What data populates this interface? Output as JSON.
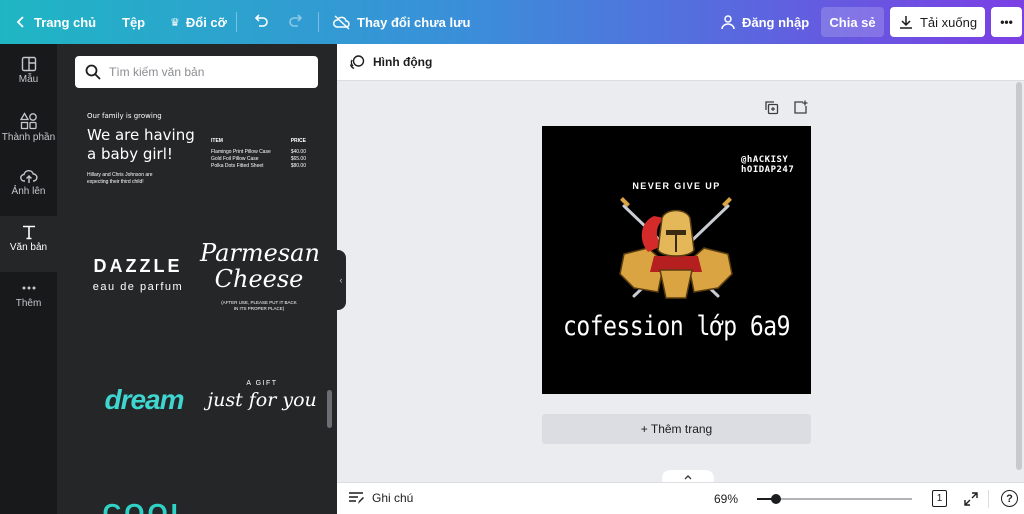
{
  "topbar": {
    "home_label": "Trang chủ",
    "file_label": "Tệp",
    "resize_label": "Đổi cỡ",
    "status_label": "Thay đổi chưa lưu",
    "login_label": "Đăng nhập",
    "share_label": "Chia sẻ",
    "download_label": "Tải xuống",
    "more_label": "•••"
  },
  "rail": {
    "items": [
      {
        "label": "Mẫu",
        "icon": "template-icon"
      },
      {
        "label": "Thành phần",
        "icon": "shapes-icon"
      },
      {
        "label": "Ảnh lên",
        "icon": "upload-cloud-icon"
      },
      {
        "label": "Văn bản",
        "icon": "text-icon"
      },
      {
        "label": "Thêm",
        "icon": "more-dots-icon"
      }
    ]
  },
  "panel": {
    "search_placeholder": "Tìm kiếm văn bản",
    "tile_baby": {
      "small": "Our family is growing",
      "line1": "We are having",
      "line2": "a baby girl!",
      "foot1": "Hillary and Chris Johnson are",
      "foot2": "expecting their third child!"
    },
    "tile_price": {
      "head_item": "ITEM",
      "head_price": "PRICE",
      "rows": [
        {
          "item": "Flamingo Print Pillow Case",
          "price": "$40.00"
        },
        {
          "item": "Gold Foil Pillow Case",
          "price": "$65.00"
        },
        {
          "item": "Polka Dots Fitted Sheet",
          "price": "$80.00"
        }
      ]
    },
    "tile_dazzle": {
      "title": "DAZZLE",
      "sub": "eau de parfum"
    },
    "tile_parmesan": {
      "line1": "Parmesan",
      "line2": "Cheese",
      "foot1": "(AFTER USE, PLEASE PUT IT BACK",
      "foot2": "IN ITS PROPER PLACE)"
    },
    "tile_dream": {
      "text": "dream"
    },
    "tile_gift": {
      "small": "A GIFT",
      "script": "just for you"
    },
    "tile_cool": {
      "text": "COOL"
    }
  },
  "editor": {
    "animate_label": "Hình động",
    "add_page_label": "+ Thêm trang"
  },
  "design": {
    "handle1": "@hACKISY",
    "handle2": "hOIDAP247",
    "motto": "NEVER GIVE UP",
    "title": "cofession lớp 6a9",
    "background": "#000000"
  },
  "footer": {
    "notes_label": "Ghi chú",
    "zoom": "69%",
    "zoom_level": 0.12,
    "page_count": "1"
  },
  "colors": {
    "topbar_gradient_start": "#1fb6c4",
    "topbar_gradient_end": "#7b3fe4",
    "panel_bg": "#252627",
    "rail_bg": "#18191b",
    "canvas_bg": "#ebecf0"
  }
}
